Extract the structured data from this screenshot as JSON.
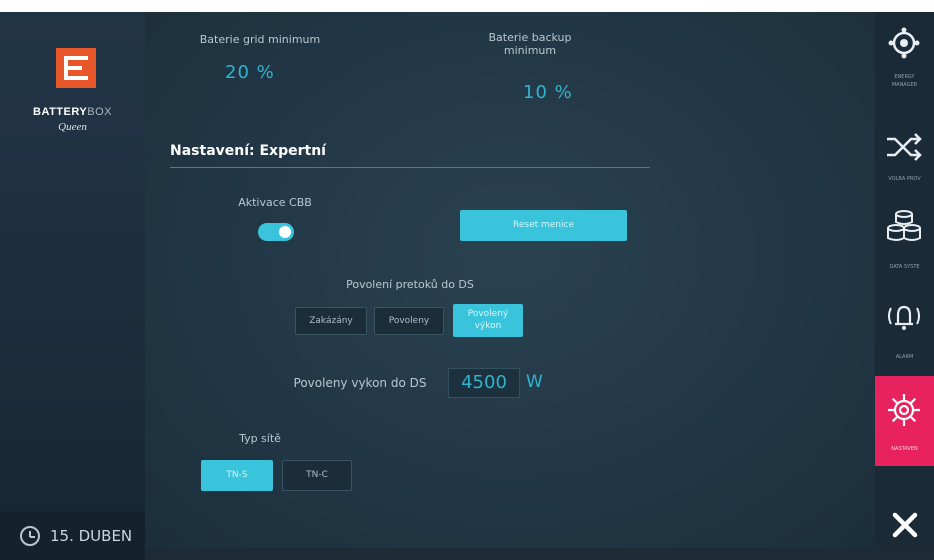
{
  "brand": {
    "name_bold": "BATTERY",
    "name_light": "BOX",
    "sub": "Queen",
    "logo_color": "#e8572a"
  },
  "footer": {
    "date": "15. DUBEN"
  },
  "battery": {
    "grid_min_label": "Baterie grid minimum",
    "grid_min_value": "20",
    "grid_min_unit": "%",
    "backup_min_label_1": "Baterie backup",
    "backup_min_label_2": "minimum",
    "backup_min_value": "10",
    "backup_min_unit": "%"
  },
  "expert": {
    "title": "Nastavení: Expertní",
    "cbb_label": "Aktivace CBB",
    "cbb_on": true,
    "reset_button": "Reset menice",
    "flow_label": "Povolení pretoků do DS",
    "flow_options": [
      "Zakázány",
      "Povoleny",
      "Povolený",
      "výkon"
    ],
    "power_label": "Povoleny vykon do DS",
    "power_value": "4500",
    "power_unit": "W",
    "network_label": "Typ sítě",
    "network_options": [
      "TN-S",
      "TN-C"
    ]
  },
  "nav": [
    {
      "icon": "energy-manager-icon",
      "label_1": "ENERGY",
      "label_2": "MANAGER"
    },
    {
      "icon": "shuffle-icon",
      "label_1": "VOLBA PROV"
    },
    {
      "icon": "database-icon",
      "label_1": "DATA SYSTE"
    },
    {
      "icon": "alarm-icon",
      "label_1": "ALARM"
    },
    {
      "icon": "gear-icon",
      "label_1": "NASTAVEN"
    },
    {
      "icon": "close-icon"
    }
  ],
  "colors": {
    "accent": "#39c4dc",
    "active_nav": "#e8215f",
    "value_text": "#2fb4cf"
  }
}
